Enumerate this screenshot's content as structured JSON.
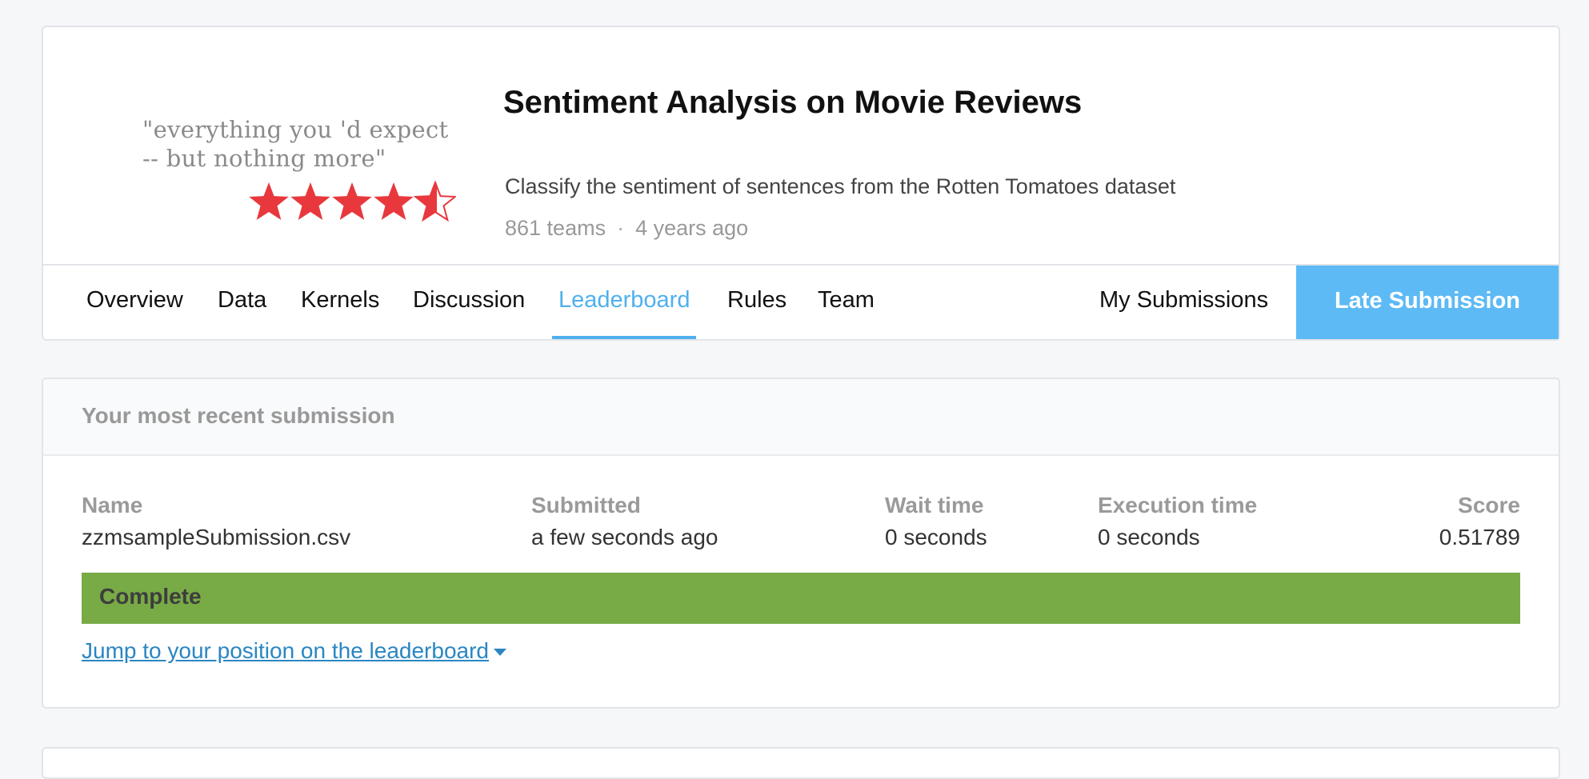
{
  "competition": {
    "thumbnail": {
      "quote_line1": "\"everything you 'd expect",
      "quote_line2": "-- but nothing more\"",
      "star_rating": 4.5,
      "star_color": "#e8383d"
    },
    "title": "Sentiment Analysis on Movie Reviews",
    "description": "Classify the sentiment of sentences from the Rotten Tomatoes dataset",
    "teams": "861 teams",
    "separator": "·",
    "age": "4 years ago"
  },
  "nav": {
    "tabs": [
      {
        "label": "Overview"
      },
      {
        "label": "Data"
      },
      {
        "label": "Kernels"
      },
      {
        "label": "Discussion"
      },
      {
        "label": "Leaderboard",
        "active": true
      },
      {
        "label": "Rules"
      },
      {
        "label": "Team"
      }
    ],
    "my_submissions": "My Submissions",
    "late_submission": "Late Submission"
  },
  "submission": {
    "section_title": "Your most recent submission",
    "columns": {
      "name": {
        "header": "Name",
        "value": "zzmsampleSubmission.csv"
      },
      "submitted": {
        "header": "Submitted",
        "value": "a few seconds ago"
      },
      "wait": {
        "header": "Wait time",
        "value": "0 seconds"
      },
      "execution": {
        "header": "Execution time",
        "value": "0 seconds"
      },
      "score": {
        "header": "Score",
        "value": "0.51789"
      }
    },
    "status": "Complete",
    "jump_link": "Jump to your position on the leaderboard"
  },
  "colors": {
    "accent": "#5dbaf5",
    "active_tab": "#4fb0ee",
    "status_complete": "#78aa46",
    "link": "#2a86c2"
  }
}
